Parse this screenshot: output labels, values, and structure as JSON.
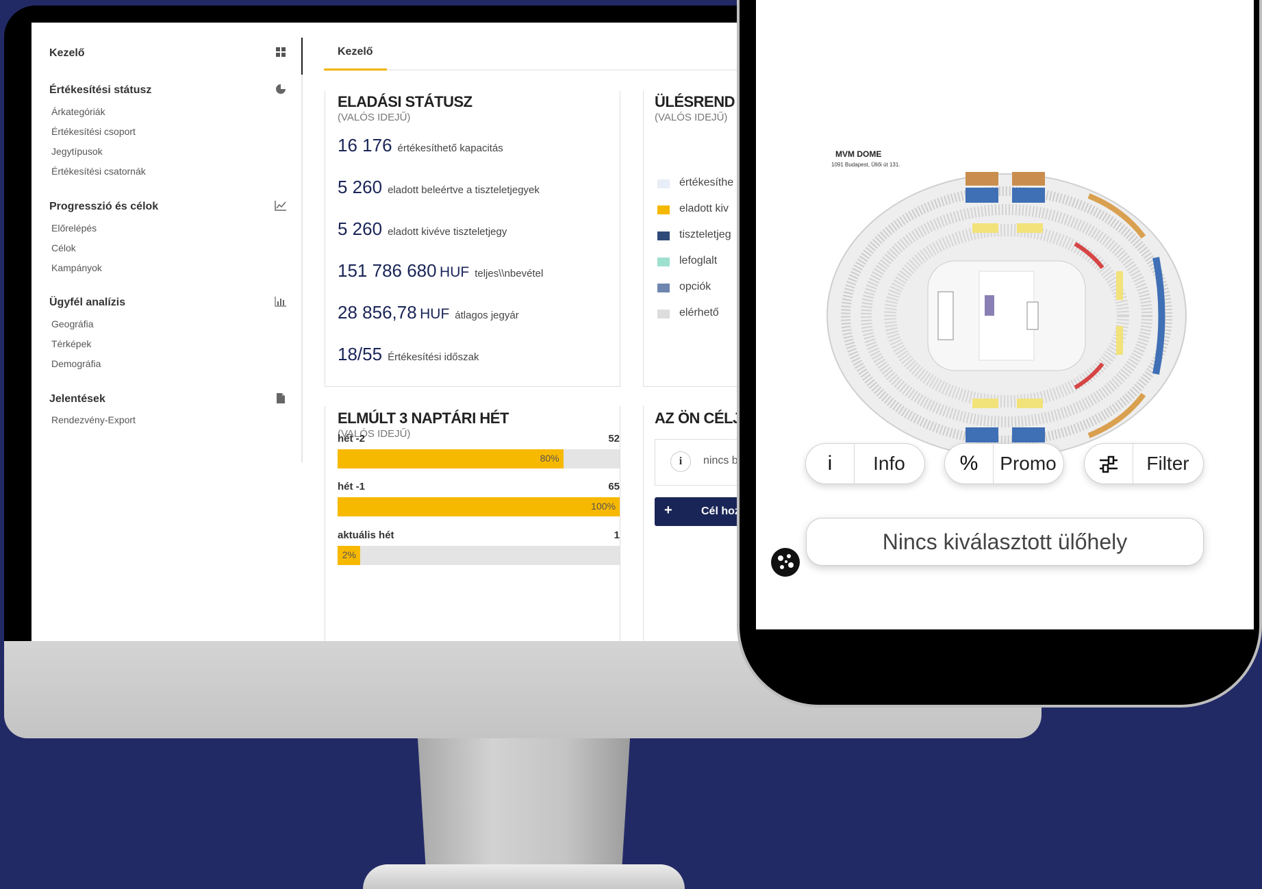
{
  "sidebar": {
    "title": "Kezelő",
    "sections": [
      {
        "heading": "Értékesítési státusz",
        "icon": "pie-chart-icon",
        "items": [
          "Árkategóriák",
          "Értékesítési csoport",
          "Jegytípusok",
          "Értékesítési csatornák"
        ]
      },
      {
        "heading": "Progresszió és célok",
        "icon": "line-chart-icon",
        "items": [
          "Előrelépés",
          "Célok",
          "Kampányok"
        ]
      },
      {
        "heading": "Ügyfél analízis",
        "icon": "bar-chart-icon",
        "items": [
          "Geográfia",
          "Térképek",
          "Demográfia"
        ]
      },
      {
        "heading": "Jelentések",
        "icon": "document-icon",
        "items": [
          "Rendezvény-Export"
        ]
      }
    ]
  },
  "tab": {
    "label": "Kezelő"
  },
  "sales_status": {
    "title": "ELADÁSI STÁTUSZ",
    "subtitle": "(VALÓS IDEJŰ)",
    "stats": [
      {
        "value": "16 176",
        "unit": "",
        "label": "értékesíthető kapacitás"
      },
      {
        "value": "5 260",
        "unit": "",
        "label": "eladott beleértve a tiszteletjegyek"
      },
      {
        "value": "5 260",
        "unit": "",
        "label": "eladott kivéve tiszteletjegy"
      },
      {
        "value": "151 786 680",
        "unit": "HUF",
        "label": "teljes\\\\nbevétel"
      },
      {
        "value": "28 856,78",
        "unit": "HUF",
        "label": "átlagos jegyár"
      },
      {
        "value": "18/55",
        "unit": "",
        "label": "Értékesítési időszak"
      }
    ]
  },
  "seating": {
    "title": "ÜLÉSREND A",
    "subtitle": "(VALÓS IDEJŰ)",
    "legend": [
      {
        "label": "értékesíthe",
        "color": "#e8eef7"
      },
      {
        "label": "eladott kiv",
        "color": "#f5b800"
      },
      {
        "label": "tiszteletjeg",
        "color": "#2f4a78"
      },
      {
        "label": "lefoglalt",
        "color": "#9ee0d0"
      },
      {
        "label": "opciók",
        "color": "#6f86b0"
      },
      {
        "label": "elérhető",
        "color": "#dddddd"
      }
    ]
  },
  "weeks": {
    "title": "ELMÚLT 3 NAPTÁRI HÉT",
    "subtitle": "(VALÓS IDEJŰ)",
    "rows": [
      {
        "label": "hét -2",
        "count": "52",
        "percent": 80,
        "percent_label": "80%"
      },
      {
        "label": "hét -1",
        "count": "65",
        "percent": 100,
        "percent_label": "100%"
      },
      {
        "label": "aktuális hét",
        "count": "1",
        "percent": 2,
        "percent_label": "2%"
      }
    ]
  },
  "goals": {
    "title": "AZ ÖN CÉLJ",
    "info_text": "nincs b",
    "add_button": "Cél hoz"
  },
  "phone": {
    "venue_name": "MVM DOME",
    "venue_address": "1091 Budapest, Üllői út 131.",
    "buttons": [
      {
        "icon": "info-icon",
        "glyph": "i",
        "label": "Info"
      },
      {
        "icon": "percent-icon",
        "glyph": "%",
        "label": "Promo"
      },
      {
        "icon": "sliders-icon",
        "glyph": "⚌",
        "label": "Filter"
      }
    ],
    "seat_status": "Nincs kiválasztott ülőhely"
  },
  "colors": {
    "accent": "#f7b800",
    "navy": "#1a2557",
    "background": "#222a66"
  }
}
